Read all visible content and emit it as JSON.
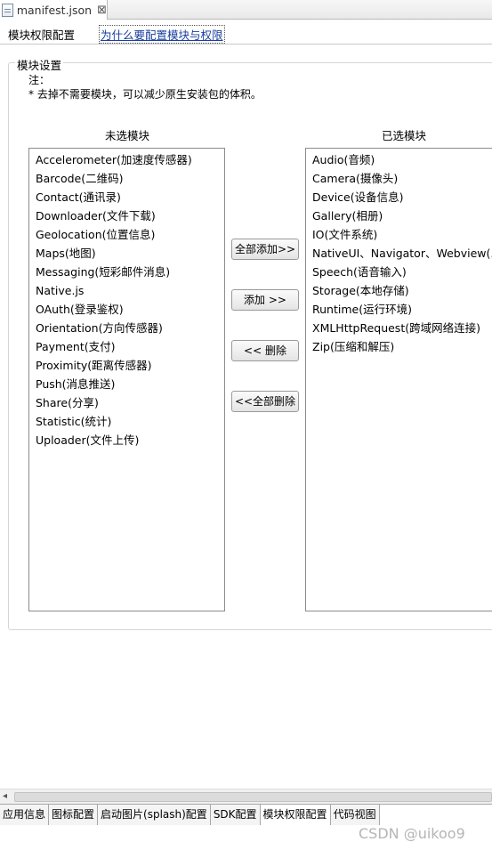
{
  "editor_tab": {
    "file_name": "manifest.json",
    "close_glyph": "⊠"
  },
  "header": {
    "title": "模块权限配置",
    "help_link": "为什么要配置模块与权限"
  },
  "group": {
    "title": "模块设置",
    "note_label": "注：",
    "note_text": "* 去掉不需要模块，可以减少原生安装包的体积。"
  },
  "unselected": {
    "label": "未选模块",
    "items": [
      "Accelerometer(加速度传感器)",
      "Barcode(二维码)",
      "Contact(通讯录)",
      "Downloader(文件下载)",
      "Geolocation(位置信息)",
      "Maps(地图)",
      "Messaging(短彩邮件消息)",
      "Native.js",
      "OAuth(登录鉴权)",
      "Orientation(方向传感器)",
      "Payment(支付)",
      "Proximity(距离传感器)",
      "Push(消息推送)",
      "Share(分享)",
      "Statistic(统计)",
      "Uploader(文件上传)"
    ]
  },
  "selected": {
    "label": "已选模块",
    "items": [
      "Audio(音频)",
      "Camera(摄像头)",
      "Device(设备信息)",
      "Gallery(相册)",
      "IO(文件系统)",
      "NativeUI、Navigator、Webview(...",
      "Speech(语音输入)",
      "Storage(本地存储)",
      "Runtime(运行环境)",
      "XMLHttpRequest(跨域网络连接)",
      "Zip(压缩和解压)"
    ]
  },
  "buttons": {
    "add_all": "全部添加>>",
    "add": "添加  >>",
    "remove": "<< 删除",
    "remove_all": "<<全部删除"
  },
  "scrollbar": {
    "left_arrow": "◂"
  },
  "bottom_tabs": [
    {
      "label": "应用信息",
      "active": false
    },
    {
      "label": "图标配置",
      "active": false
    },
    {
      "label": "启动图片(splash)配置",
      "active": false
    },
    {
      "label": "SDK配置",
      "active": false
    },
    {
      "label": "模块权限配置",
      "active": true
    },
    {
      "label": "代码视图",
      "active": false
    }
  ],
  "watermark": "CSDN @uikoo9"
}
